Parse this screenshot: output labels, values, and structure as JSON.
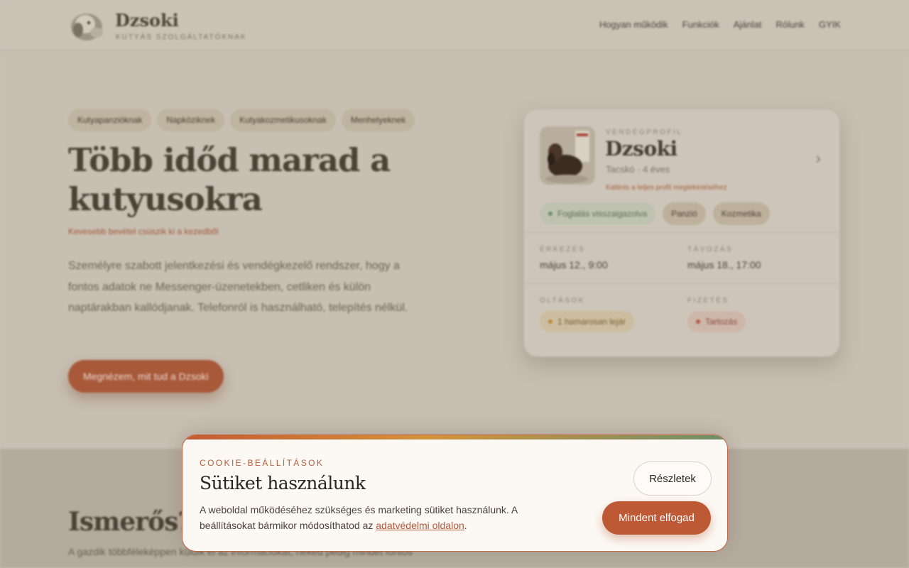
{
  "header": {
    "brand_name": "Dzsoki",
    "brand_tagline": "KUTYÁS SZOLGÁLTATÓKNAK",
    "nav": [
      "Hogyan működik",
      "Funkciók",
      "Ajánlat",
      "Rólunk",
      "GYIK"
    ]
  },
  "hero": {
    "chips": [
      "Kutyapanzióknak",
      "Napköziknek",
      "Kutyakozmetikusoknak",
      "Menhelyeknek"
    ],
    "title": "Több időd marad a kutyusokra",
    "subtitle": "Kevesebb bevétel csúszik ki a kezedből",
    "text": "Személyre szabott jelentkezési és vendégkezelő rendszer, hogy a fontos adatok ne Messenger-üzenetekben, cetliken és külön naptárakban kallódjanak. Telefonról is használható, telepítés nélkül.",
    "cta": "Megnézem, mit tud a Dzsoki"
  },
  "card": {
    "eyebrow": "VENDÉGPROFIL",
    "pet_name": "Dzsoki",
    "pet_meta": "Tacskó · 4 éves",
    "pet_link": "Kattints a teljes profil megtekintéséhez",
    "tags": [
      "Foglalás visszaigazolva",
      "Panzió",
      "Kozmetika"
    ],
    "arrival_label": "ÉRKEZÉS",
    "arrival_value": "május 12., 9:00",
    "departure_label": "TÁVOZÁS",
    "departure_value": "május 18., 17:00",
    "vaccines_label": "OLTÁSOK",
    "vaccines_value": "1 hamarosan lejár",
    "payment_label": "FIZETÉS",
    "payment_value": "Tartozás"
  },
  "section2": {
    "title": "Ismerős?",
    "text": "A gazdik többféleképpen küldik el az információkat, neked pedig mindet fontos"
  },
  "cookie": {
    "eyebrow": "COOKIE-BEÁLLÍTÁSOK",
    "title": "Sütiket használunk",
    "body_text": "A weboldal működéséhez szükséges és marketing sütiket használunk. A beállításokat bármikor módosíthatod az ",
    "link_text": "adatvédelmi oldalon",
    "body_end": ".",
    "details_button": "Részletek",
    "accept_button": "Mindent elfogad"
  },
  "colors": {
    "accent": "#bd5a35",
    "gradient": [
      "#c25b34",
      "#d2923a",
      "#6f8f6a"
    ],
    "cookie_bg": "#fcf9f4"
  }
}
